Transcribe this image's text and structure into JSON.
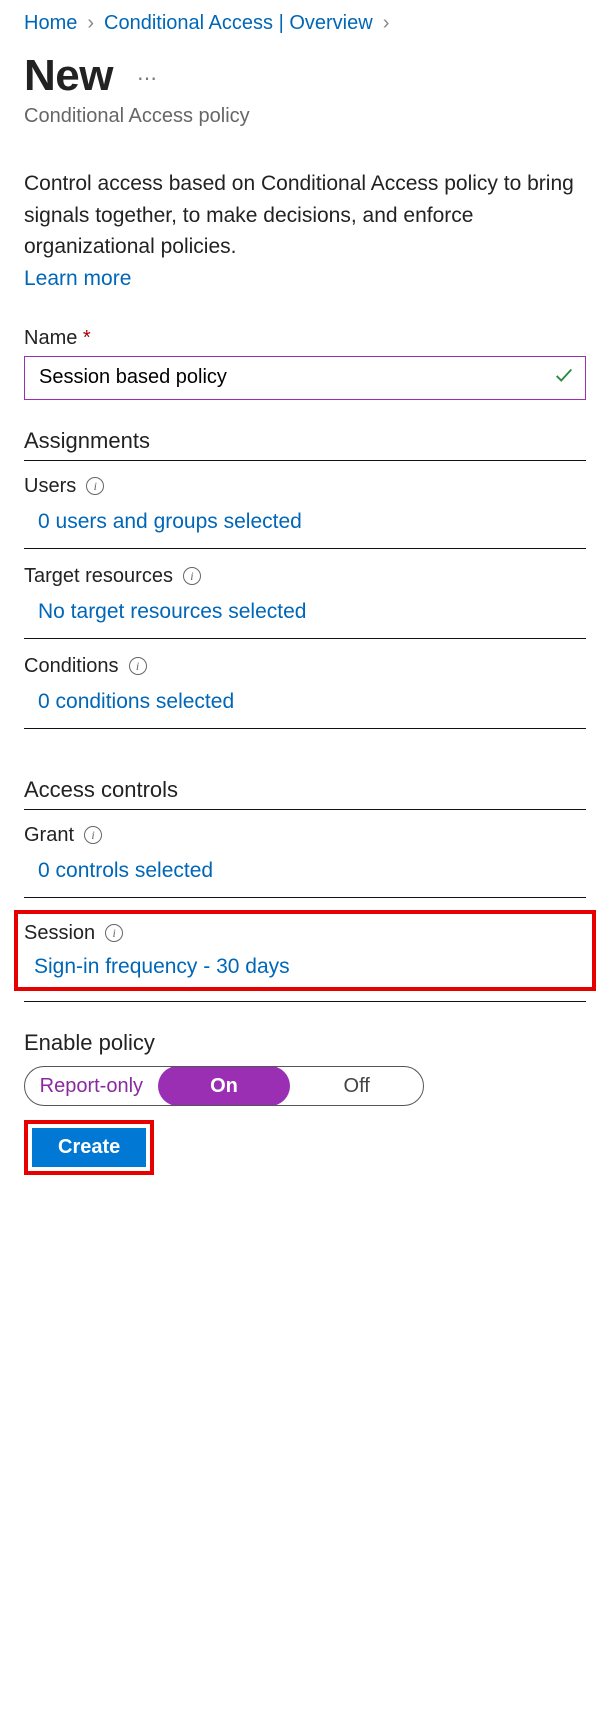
{
  "breadcrumb": {
    "home": "Home",
    "overview": "Conditional Access | Overview"
  },
  "title": "New",
  "subtitle": "Conditional Access policy",
  "description": "Control access based on Conditional Access policy to bring signals together, to make decisions, and enforce organizational policies.",
  "learn_more": "Learn more",
  "name_field": {
    "label": "Name",
    "value": "Session based policy"
  },
  "assignments": {
    "heading": "Assignments",
    "users": {
      "label": "Users",
      "summary": "0 users and groups selected"
    },
    "target": {
      "label": "Target resources",
      "summary": "No target resources selected"
    },
    "conditions": {
      "label": "Conditions",
      "summary": "0 conditions selected"
    }
  },
  "access_controls": {
    "heading": "Access controls",
    "grant": {
      "label": "Grant",
      "summary": "0 controls selected"
    },
    "session": {
      "label": "Session",
      "summary": "Sign-in frequency - 30 days"
    }
  },
  "enable_policy": {
    "label": "Enable policy",
    "options": {
      "report_only": "Report-only",
      "on": "On",
      "off": "Off"
    },
    "selected": "On"
  },
  "create_button": "Create"
}
